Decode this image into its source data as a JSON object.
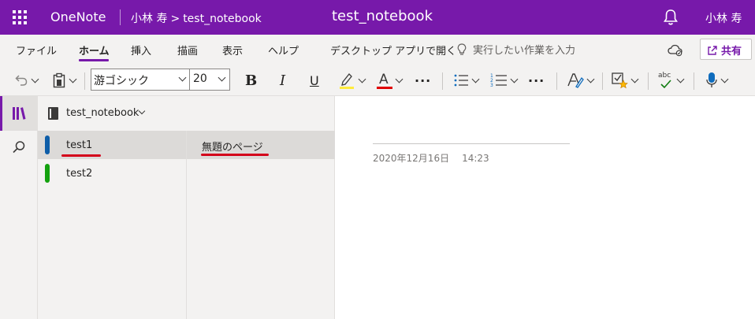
{
  "titlebar": {
    "app_name": "OneNote",
    "breadcrumb_user": "小林 寿",
    "breadcrumb_separator": ">",
    "breadcrumb_notebook": "test_notebook",
    "document_title": "test_notebook",
    "user_name": "小林 寿",
    "bg_color": "#7719aa"
  },
  "ribbon": {
    "tabs": [
      {
        "label": "ファイル"
      },
      {
        "label": "ホーム",
        "active": true
      },
      {
        "label": "挿入"
      },
      {
        "label": "描画"
      },
      {
        "label": "表示"
      },
      {
        "label": "ヘルプ"
      },
      {
        "label": "デスクトップ アプリで開く"
      }
    ],
    "tell_me": "実行したい作業を入力",
    "share_label": "共有"
  },
  "toolbar": {
    "font_name": "游ゴシック",
    "font_size": "20",
    "bold": "B",
    "italic": "I",
    "underline": "U",
    "font_color_glyph": "A",
    "more": "···",
    "spell_check": "abc",
    "highlight_color": "#ffeb3b",
    "font_color": "#e00000",
    "icons": [
      "undo-icon",
      "clipboard-icon",
      "highlighter-icon",
      "bullets-icon",
      "numbering-icon",
      "styles-icon",
      "tags-icon",
      "spelling-icon",
      "dictate-icon"
    ]
  },
  "navigation": {
    "notebook_name": "test_notebook",
    "sections": [
      {
        "label": "test1",
        "color": "#0f5ea8",
        "selected": true
      },
      {
        "label": "test2",
        "color": "#13a10e",
        "selected": false
      }
    ],
    "pages": [
      {
        "label": "無題のページ",
        "selected": true
      }
    ]
  },
  "page": {
    "date": "2020年12月16日",
    "time": "14:23"
  },
  "annotation_color": "#d4001a"
}
